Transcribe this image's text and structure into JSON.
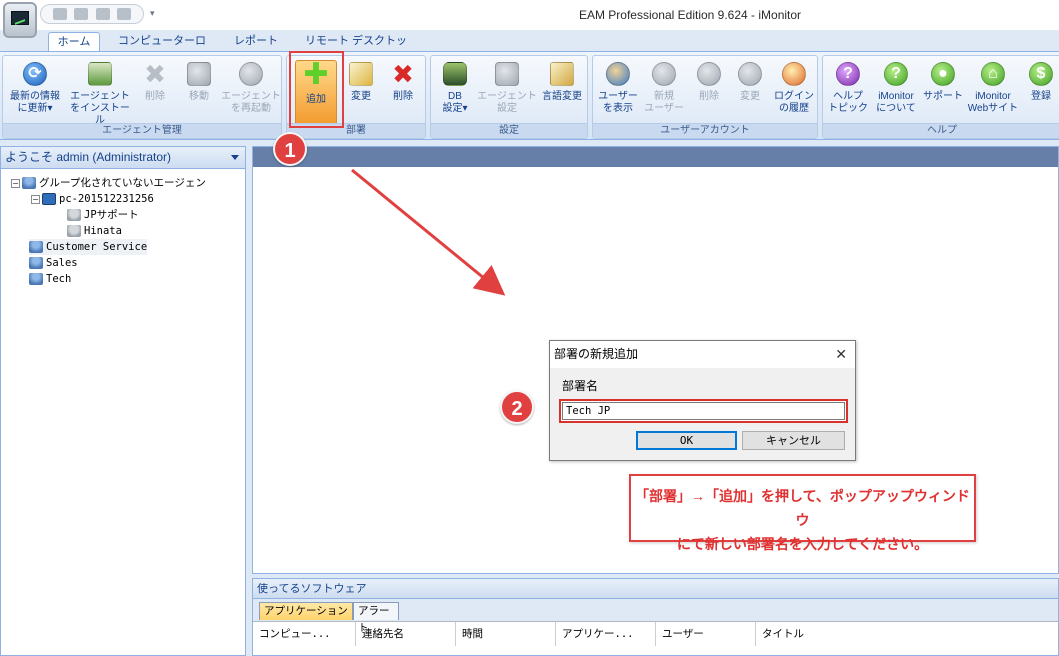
{
  "window": {
    "title": "EAM Professional Edition 9.624 - iMonitor",
    "qat_more": "▾"
  },
  "tabs": [
    {
      "label": "ホーム",
      "active": true
    },
    {
      "label": "コンピューターログ"
    },
    {
      "label": "レポート"
    },
    {
      "label": "リモート デスクトップ"
    }
  ],
  "ribbon": {
    "agent_mgmt": {
      "label": "エージェント管理",
      "refresh": "最新の情報\nに更新▾",
      "install": "エージェント\nをインストール",
      "delete": "削除",
      "move": "移動",
      "restart": "エージェント\nを再起動"
    },
    "department": {
      "label": "部署",
      "add": "追加",
      "change": "変更",
      "delete": "削除"
    },
    "settings": {
      "label": "設定",
      "db": "DB\n設定▾",
      "agent": "エージェント\n設定",
      "language": "言語変更"
    },
    "user_account": {
      "label": "ユーザーアカウント",
      "show": "ユーザー\nを表示",
      "new": "新規\nユーザー",
      "delete": "削除",
      "change": "変更",
      "login_history": "ログイン\nの履歴"
    },
    "help": {
      "label": "ヘルプ",
      "topics": "ヘルプ\nトピック",
      "about": "iMonitor\nについて",
      "support": "サポート",
      "website": "iMonitor\nWebサイト",
      "register": "登録"
    }
  },
  "tree": {
    "header": "ようこそ admin (Administrator)",
    "nodes": [
      {
        "label": "グループ化されていないエージェン",
        "expander": "−"
      },
      {
        "label": "pc-201512231256",
        "expander": "−"
      },
      {
        "label": "JPサポート"
      },
      {
        "label": "Hinata"
      },
      {
        "label": "Customer Service"
      },
      {
        "label": "Sales"
      },
      {
        "label": "Tech"
      }
    ]
  },
  "bottom": {
    "title": "使ってるソフトウェア",
    "tabs": [
      "アプリケーション",
      "アラート"
    ],
    "columns": [
      "コンピュー...",
      "連絡先名",
      "時間",
      "アプリケー...",
      "ユーザー",
      "タイトル"
    ]
  },
  "dialog": {
    "title": "部署の新規追加",
    "close": "✕",
    "field_label": "部署名",
    "field_value": "Tech JP",
    "ok": "OK",
    "cancel": "キャンセル"
  },
  "annotations": {
    "badge1": "1",
    "badge2": "2",
    "note_line1": "「部署」→「追加」を押して、ポップアップウィンドウ",
    "note_line2": "にて新しい部署名を入力してください。"
  },
  "colors": {
    "annotation_red": "#e04040",
    "ribbon_bg": "#dfe9f5",
    "main_bar": "#657fa8"
  }
}
